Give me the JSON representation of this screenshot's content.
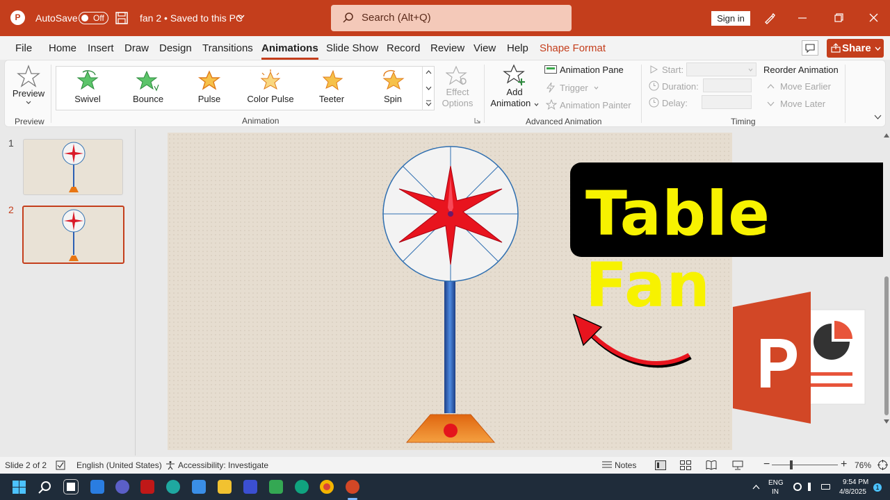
{
  "titlebar": {
    "autosave_label": "AutoSave",
    "autosave_state": "Off",
    "doc_title": "fan 2 • Saved to this PC",
    "search_placeholder": "Search (Alt+Q)",
    "sign_in": "Sign in"
  },
  "menu": {
    "tabs": [
      "File",
      "Home",
      "Insert",
      "Draw",
      "Design",
      "Transitions",
      "Animations",
      "Slide Show",
      "Record",
      "Review",
      "View",
      "Help",
      "Shape Format"
    ],
    "active": "Animations",
    "share": "Share"
  },
  "ribbon": {
    "preview": {
      "button": "Preview",
      "group": "Preview"
    },
    "animation_group": "Animation",
    "animations": [
      "Swivel",
      "Bounce",
      "Pulse",
      "Color Pulse",
      "Teeter",
      "Spin"
    ],
    "effect_options": "Effect Options",
    "advanced": {
      "group": "Advanced Animation",
      "add_animation_1": "Add",
      "add_animation_2": "Animation",
      "animation_pane": "Animation Pane",
      "trigger": "Trigger",
      "animation_painter": "Animation Painter"
    },
    "timing": {
      "group": "Timing",
      "start": "Start:",
      "duration": "Duration:",
      "delay": "Delay:",
      "reorder": "Reorder Animation",
      "move_earlier": "Move Earlier",
      "move_later": "Move Later"
    }
  },
  "thumbnails": {
    "numbers": [
      "1",
      "2"
    ],
    "selected": "2"
  },
  "slide": {
    "banner_text": "Table Fan"
  },
  "status": {
    "slide_info": "Slide 2 of 2",
    "language": "English (United States)",
    "accessibility": "Accessibility: Investigate",
    "notes": "Notes",
    "zoom": "76%"
  },
  "taskbar": {
    "lang_1": "ENG",
    "lang_2": "IN",
    "time": "9:54 PM",
    "date": "4/8/2025",
    "notification_count": "1"
  },
  "colors": {
    "accent": "#c43e1c",
    "banner_text": "#f7f200",
    "fan_blade": "#e8141e",
    "fan_pole": "#2c5fb3",
    "fan_base": "#e87512"
  }
}
